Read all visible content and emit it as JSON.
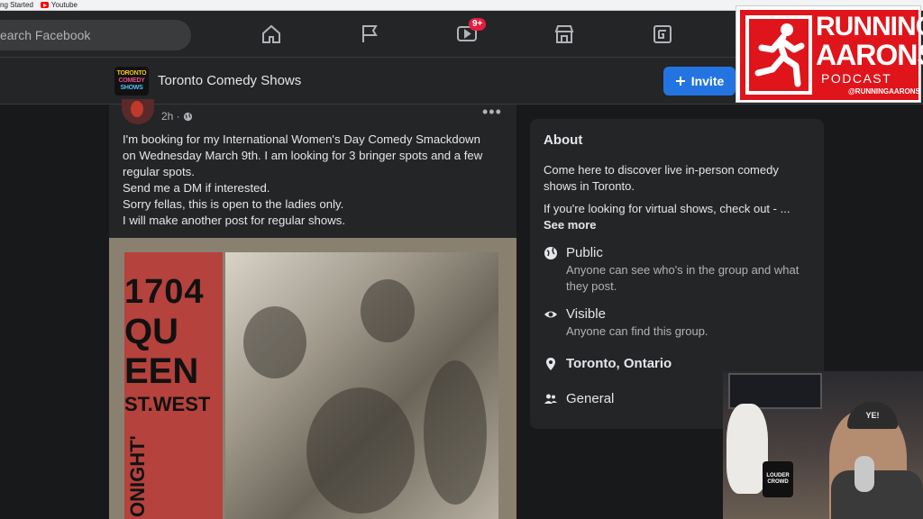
{
  "bookmarks": [
    {
      "label": "ng Started"
    },
    {
      "label": "Youtube"
    }
  ],
  "topnav": {
    "search_placeholder": "earch Facebook",
    "watch_badge": "9+",
    "icons": [
      "home-icon",
      "flag-icon",
      "watch-icon",
      "marketplace-icon",
      "gaming-icon"
    ]
  },
  "group": {
    "logo_lines": [
      "TORONTO",
      "COMEDY",
      "SHOWS"
    ],
    "name": "Toronto Comedy Shows",
    "invite_label": "Invite"
  },
  "post": {
    "time": "2h ·",
    "more": "•••",
    "lines": [
      "I'm booking for my International Women's Day Comedy Smackdown",
      "on Wednesday March 9th. I am looking for 3 bringer spots and a few",
      "regular spots.",
      "Send me a DM if interested.",
      "Sorry fellas, this is open to the ladies only.",
      "I will make another post for regular shows."
    ],
    "poster": {
      "line1": "1704",
      "line2": "QU",
      "line3": "EEN",
      "line4": "ST.WEST",
      "side": "ONIGHT'"
    }
  },
  "about": {
    "title": "About",
    "desc1": "Come here to discover live in-person comedy shows in Toronto.",
    "desc2": "If you're looking for virtual shows, check out - ...",
    "see_more": "See more",
    "privacy_title": "Public",
    "privacy_desc": "Anyone can see who's in the group and what they post.",
    "visibility_title": "Visible",
    "visibility_desc": "Anyone can find this group.",
    "location": "Toronto, Ontario",
    "category": "General"
  },
  "overlay": {
    "podcast_line1": "RUNNING",
    "podcast_line2": "AARONS",
    "podcast_line3": "PODCAST",
    "podcast_handle": "@RUNNINGAARONS",
    "webcam_hat": "YE!",
    "webcam_mug": "LOUDER CROWD"
  },
  "colors": {
    "background": "#18191a",
    "card": "#242526",
    "accent": "#2374e1",
    "badge": "#e41e3f",
    "podcast_red": "#e0151b"
  }
}
